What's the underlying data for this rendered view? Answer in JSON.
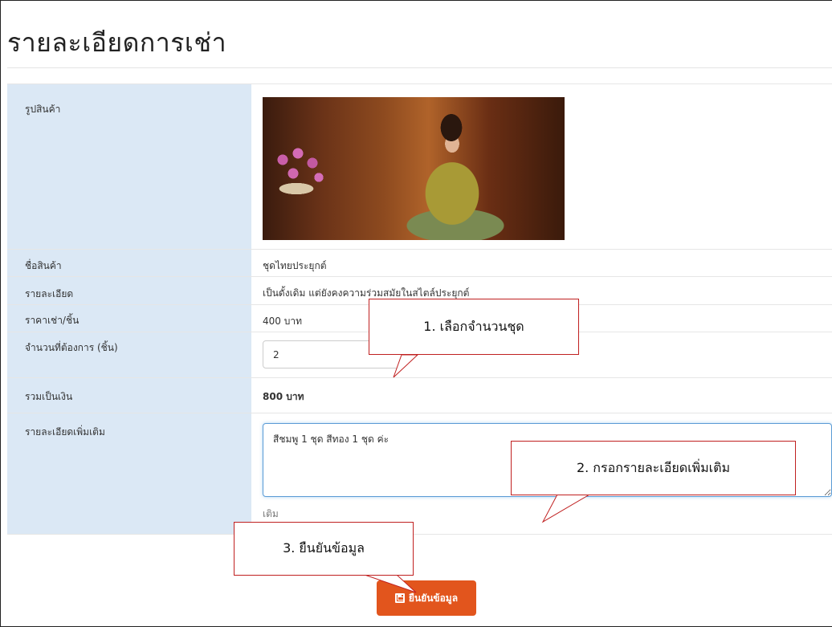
{
  "page": {
    "title": "รายละเอียดการเช่า"
  },
  "details": {
    "image_label": "รูปสินค้า",
    "name_label": "ชื่อสินค้า",
    "name_value": "ชุดไทยประยุกต์",
    "description_label": "รายละเอียด",
    "description_value": "เป็นดั้งเดิม แต่ยังคงความร่วมสมัยในสไตล์ประยุกต์",
    "price_label": "ราคาเช่า/ชิ้น",
    "price_value": "400 บาท",
    "quantity_label": "จำนวนที่ต้องการ (ชิ้น)",
    "quantity_value": "2",
    "total_label": "รวมเป็นเงิน",
    "total_value": "800 บาท",
    "notes_label": "รายละเอียดเพิ่มเติม",
    "notes_value": "สีชมพู 1 ชุด สีทอง 1 ชุด ค่ะ",
    "notes_help": "เติม"
  },
  "submit": {
    "label": "ยืนยันข้อมูล",
    "icon": "save-icon",
    "color": "#e2551d"
  },
  "callouts": [
    {
      "text": "1. เลือกจำนวนชุด"
    },
    {
      "text": "2. กรอกรายละเอียดเพิ่มเติม"
    },
    {
      "text": "3. ยืนยันข้อมูล"
    }
  ],
  "colors": {
    "label_bg": "#dbe8f5",
    "callout_border": "#c02020",
    "focus_border": "#5b9bd5"
  }
}
